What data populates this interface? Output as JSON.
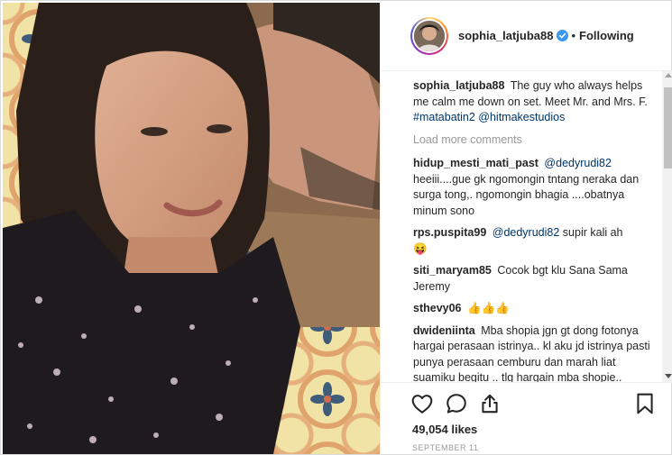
{
  "post": {
    "username": "sophia_latjuba88",
    "follow_state": "Following",
    "dot": "•",
    "caption": {
      "text": "The guy who always helps me calm me down on set. Meet Mr. and Mrs. F. ",
      "tags": "#matabatin2 @hitmakestudios"
    },
    "load_more": "Load more comments",
    "comments": [
      {
        "user": "hidup_mesti_mati_past",
        "mention": "@dedyrudi82",
        "text": "heeiii....gue gk ngomongin tntang neraka dan surga tong,. ngomongin bhagia ....obatnya minum sono"
      },
      {
        "user": "rps.puspita99",
        "mention": "@dedyrudi82",
        "text": "supir kali ah",
        "emoji": "😝"
      },
      {
        "user": "siti_maryam85",
        "mention": "",
        "text": "Cocok bgt klu Sana Sama Jeremy"
      },
      {
        "user": "sthevy06",
        "mention": "",
        "text": "👍👍👍"
      },
      {
        "user": "dwideniinta",
        "mention": "",
        "text": "Mba shopia jgn gt dong fotonya hargai perasaan istrinya.. kl aku jd istrinya pasti punya perasaan cemburu dan marah liat suamiku begitu .. tlg hargain mba shopie.. apalgi dgn sttus mba shopie"
      }
    ],
    "likes": "49,054 likes",
    "date": "SEPTEMBER 11"
  },
  "icons": {
    "like": "heart-icon",
    "comment": "comment-bubble-icon",
    "share": "share-icon",
    "save": "bookmark-icon",
    "verified": "verified-badge-icon"
  },
  "colors": {
    "text": "#262626",
    "mention": "#003569",
    "muted": "#999999",
    "verified": "#3897f0",
    "border": "#efefef"
  }
}
